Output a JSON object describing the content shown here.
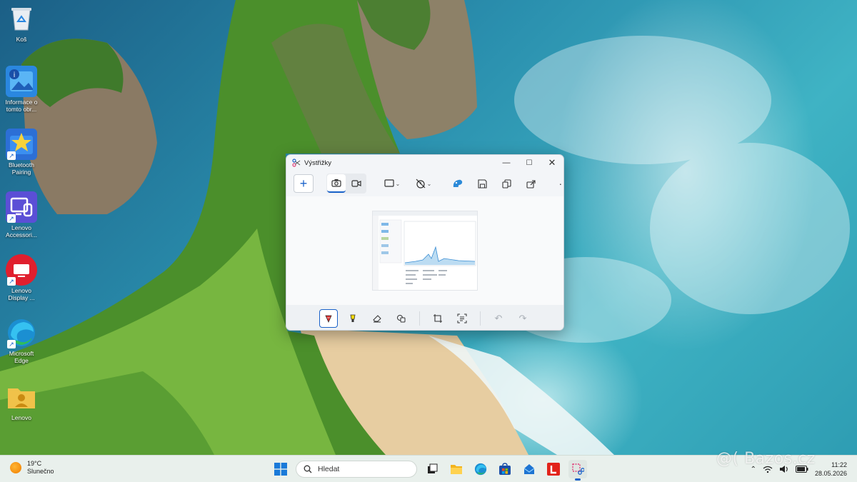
{
  "desktop": {
    "icons": [
      {
        "label": "Koš",
        "icon": "recycle-bin-icon",
        "color": "#dde6ee"
      },
      {
        "label": "Informace o\ntomto obr...",
        "icon": "image-info-icon",
        "color": "#2a87e0"
      },
      {
        "label": "Bluetooth\nPairing",
        "icon": "bluetooth-pairing-icon",
        "color": "#2c6fd6"
      },
      {
        "label": "Lenovo\nAccessori...",
        "icon": "lenovo-accessories-icon",
        "color": "#5b4fd6"
      },
      {
        "label": "Lenovo\nDisplay ...",
        "icon": "lenovo-display-icon",
        "color": "#e01f2e"
      },
      {
        "label": "Microsoft\nEdge",
        "icon": "edge-icon",
        "color": "#1b8fd2"
      },
      {
        "label": "Lenovo",
        "icon": "user-folder-icon",
        "color": "#f0c24a"
      }
    ]
  },
  "snipping": {
    "title": "Výstřižky",
    "new_label": "+",
    "toolbar_icons": [
      "camera-icon",
      "video-icon",
      "snip-shape-icon",
      "timer-icon",
      "paint-icon",
      "save-icon",
      "copy-icon",
      "share-icon",
      "more-icon"
    ],
    "bottom_tools": [
      "ballpoint-pen-icon",
      "highlighter-icon",
      "eraser-icon",
      "shapes-icon",
      "crop-icon",
      "text-actions-icon",
      "undo-icon",
      "redo-icon"
    ]
  },
  "taskbar": {
    "weather": {
      "temp": "19°C",
      "condition": "Slunečno"
    },
    "search_placeholder": "Hledat",
    "apps": [
      "task-view-icon",
      "file-explorer-icon",
      "edge-icon",
      "store-icon",
      "mail-icon",
      "lenovo-l-icon",
      "snipping-tool-icon"
    ],
    "clock": {
      "time": "11:22",
      "date": "28.05.2026"
    }
  },
  "watermark": "@( Bazos.cz",
  "colors": {
    "accent": "#1a62c9",
    "taskbar": "#e9f0ec"
  }
}
